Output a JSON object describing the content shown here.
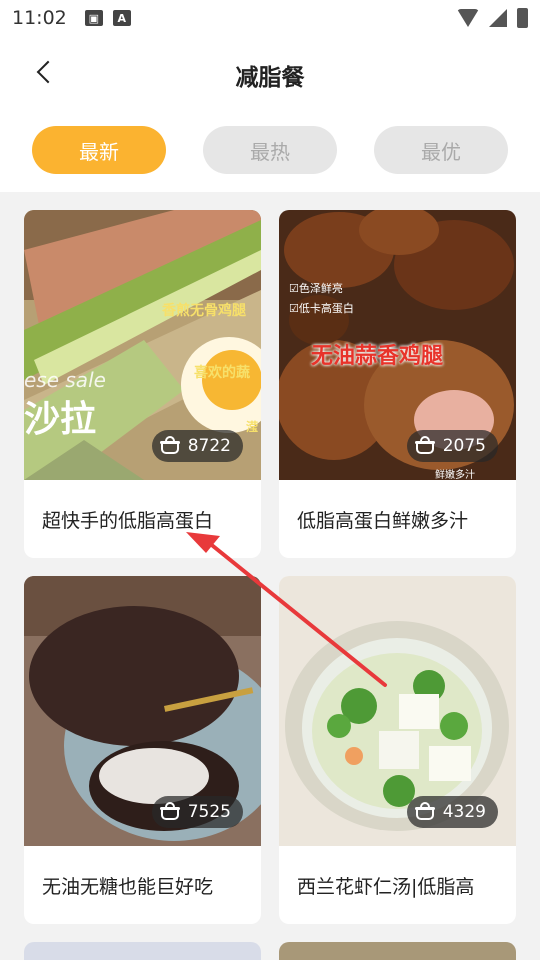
{
  "status_bar": {
    "time": "11:02",
    "icons": [
      "image-icon",
      "text-a-icon",
      "wifi-icon",
      "signal-icon",
      "battery-icon"
    ]
  },
  "header": {
    "title": "减脂餐"
  },
  "tabs": [
    {
      "label": "最新",
      "active": true
    },
    {
      "label": "最热",
      "active": false
    },
    {
      "label": "最优",
      "active": false
    }
  ],
  "cards": [
    {
      "title": "超快手的低脂高蛋白",
      "favorites": "8722",
      "image_text": [
        "香煎无骨鸡腿",
        "喜欢的蔬",
        "ese sale",
        "沙拉",
        "滢"
      ]
    },
    {
      "title": "低脂高蛋白鲜嫩多汁",
      "favorites": "2075",
      "image_text": [
        "☑色泽鲜亮",
        "☑低卡高蛋白",
        "无油蒜香鸡腿",
        "鲜嫩多汁"
      ]
    },
    {
      "title": "无油无糖也能巨好吃",
      "favorites": "7525",
      "image_text": []
    },
    {
      "title": "西兰花虾仁汤|低脂高",
      "favorites": "4329",
      "image_text": []
    }
  ],
  "colors": {
    "accent": "#fbb330",
    "inactive_tab": "#e6e6e6",
    "annotation_arrow": "#e8393b"
  }
}
